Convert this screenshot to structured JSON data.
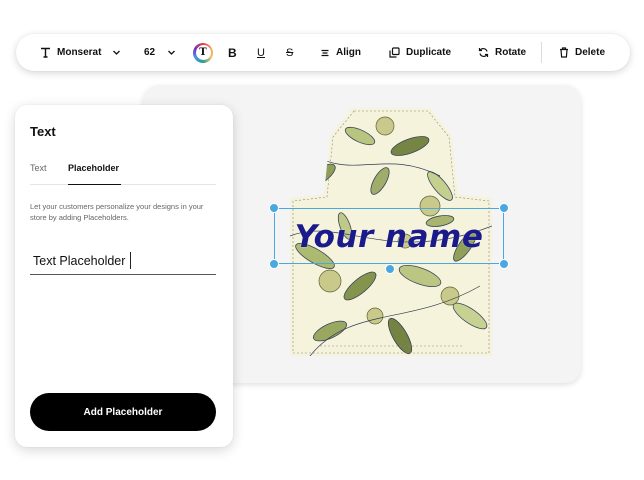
{
  "toolbar": {
    "font_name": "Monserat",
    "font_size": "62",
    "color_glyph": "T",
    "bold_glyph": "B",
    "underline_glyph": "U",
    "strike_glyph": "S",
    "align_label": "Align",
    "duplicate_label": "Duplicate",
    "rotate_label": "Rotate",
    "delete_label": "Delete"
  },
  "panel": {
    "title": "Text",
    "tabs": [
      "Text",
      "Placeholder"
    ],
    "active_tab": "Placeholder",
    "description": "Let your customers personalize your designs in your store by adding Placeholders.",
    "placeholder_value": "Text Placeholder",
    "add_button_label": "Add Placeholder"
  },
  "canvas": {
    "design_text": "Your name",
    "text_color": "#1a1a8a",
    "selection_color": "#4aa7e0"
  },
  "icons": [
    "text-type-icon",
    "chevron-down-icon",
    "text-color-icon",
    "bold-icon",
    "underline-icon",
    "strikethrough-icon",
    "align-icon",
    "duplicate-icon",
    "rotate-icon",
    "trash-icon"
  ]
}
